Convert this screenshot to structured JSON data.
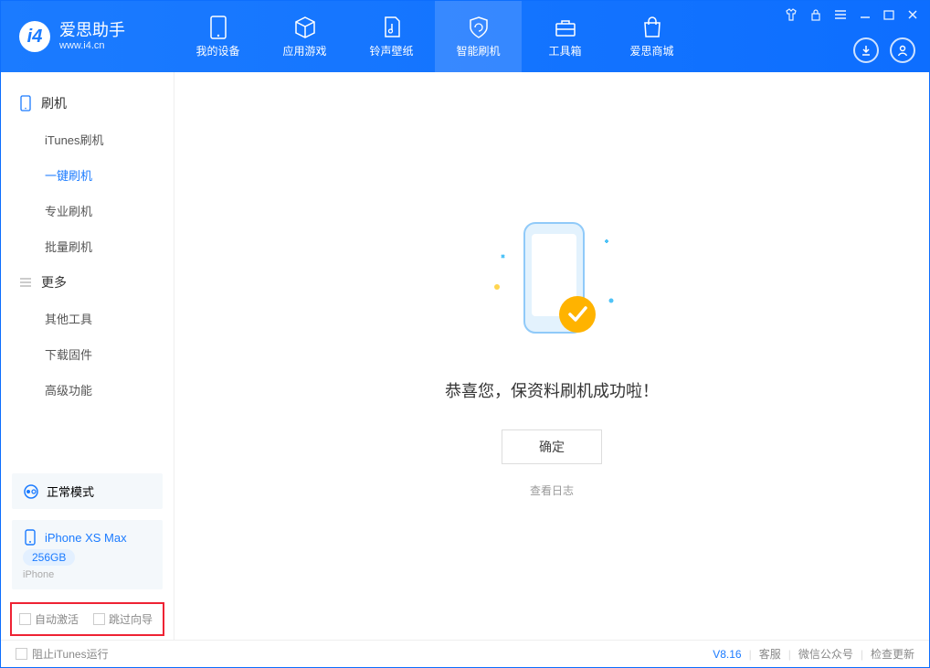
{
  "app": {
    "title": "爱思助手",
    "subtitle": "www.i4.cn"
  },
  "nav": {
    "items": [
      {
        "label": "我的设备"
      },
      {
        "label": "应用游戏"
      },
      {
        "label": "铃声壁纸"
      },
      {
        "label": "智能刷机"
      },
      {
        "label": "工具箱"
      },
      {
        "label": "爱思商城"
      }
    ]
  },
  "sidebar": {
    "group1": {
      "title": "刷机",
      "items": [
        "iTunes刷机",
        "一键刷机",
        "专业刷机",
        "批量刷机"
      ]
    },
    "group2": {
      "title": "更多",
      "items": [
        "其他工具",
        "下载固件",
        "高级功能"
      ]
    },
    "mode": "正常模式",
    "device": {
      "name": "iPhone XS Max",
      "storage": "256GB",
      "type": "iPhone"
    },
    "checks": {
      "auto_activate": "自动激活",
      "skip_guide": "跳过向导"
    }
  },
  "main": {
    "success": "恭喜您，保资料刷机成功啦！",
    "ok": "确定",
    "view_log": "查看日志"
  },
  "footer": {
    "block_itunes": "阻止iTunes运行",
    "version": "V8.16",
    "links": [
      "客服",
      "微信公众号",
      "检查更新"
    ]
  }
}
